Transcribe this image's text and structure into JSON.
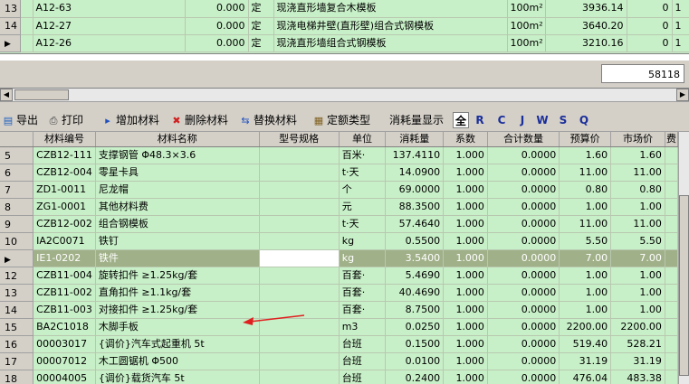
{
  "top_grid": {
    "rows": [
      {
        "num": "13",
        "code": "A12-63",
        "qty": "0.000",
        "flag": "定",
        "name": "现浇直形墙复合木模板",
        "unit": "100m²",
        "price": "3936.14",
        "a": "0",
        "b": "1"
      },
      {
        "num": "14",
        "code": "A12-27",
        "qty": "0.000",
        "flag": "定",
        "name": "现浇电梯井壁(直形壁)组合式钢模板",
        "unit": "100m²",
        "price": "3640.20",
        "a": "0",
        "b": "1"
      },
      {
        "num": "",
        "code": "A12-26",
        "qty": "0.000",
        "flag": "定",
        "name": "现浇直形墙组合式钢模板",
        "unit": "100m²",
        "price": "3210.16",
        "a": "0",
        "b": "1"
      }
    ],
    "summary_value": "58118"
  },
  "toolbar": {
    "export": "导出",
    "print": "打印",
    "add_material": "增加材料",
    "delete_material": "删除材料",
    "replace_material": "替换材料",
    "quota_type": "定额类型",
    "consumption_display": "消耗量显示",
    "letters": [
      "全",
      "R",
      "C",
      "J",
      "W",
      "S",
      "Q"
    ]
  },
  "main_grid": {
    "headers": [
      "材料编号",
      "材料名称",
      "型号规格",
      "单位",
      "消耗量",
      "系数",
      "合计数量",
      "预算价",
      "市场价",
      "费"
    ],
    "rows": [
      {
        "num": "5",
        "code": "CZB12-111",
        "name": "支撑钢管 Φ48.3×3.6",
        "spec": "",
        "unit": "百米·",
        "consumption": "137.4110",
        "coef": "1.000",
        "total": "0.0000",
        "budget": "1.60",
        "market": "1.60"
      },
      {
        "num": "6",
        "code": "CZB12-004",
        "name": "零星卡具",
        "spec": "",
        "unit": "t·天",
        "consumption": "14.0900",
        "coef": "1.000",
        "total": "0.0000",
        "budget": "11.00",
        "market": "11.00"
      },
      {
        "num": "7",
        "code": "ZD1-0011",
        "name": "尼龙帽",
        "spec": "",
        "unit": "个",
        "consumption": "69.0000",
        "coef": "1.000",
        "total": "0.0000",
        "budget": "0.80",
        "market": "0.80"
      },
      {
        "num": "8",
        "code": "ZG1-0001",
        "name": "其他材料费",
        "spec": "",
        "unit": "元",
        "consumption": "88.3500",
        "coef": "1.000",
        "total": "0.0000",
        "budget": "1.00",
        "market": "1.00"
      },
      {
        "num": "9",
        "code": "CZB12-002",
        "name": "组合钢模板",
        "spec": "",
        "unit": "t·天",
        "consumption": "57.4640",
        "coef": "1.000",
        "total": "0.0000",
        "budget": "11.00",
        "market": "11.00"
      },
      {
        "num": "10",
        "code": "IA2C0071",
        "name": "铁钉",
        "spec": "",
        "unit": "kg",
        "consumption": "0.5500",
        "coef": "1.000",
        "total": "0.0000",
        "budget": "5.50",
        "market": "5.50"
      },
      {
        "num": "",
        "code": "IE1-0202",
        "name": "铁件",
        "spec": "",
        "unit": "kg",
        "consumption": "3.5400",
        "coef": "1.000",
        "total": "0.0000",
        "budget": "7.00",
        "market": "7.00"
      },
      {
        "num": "12",
        "code": "CZB11-004",
        "name": "旋转扣件 ≥1.25kg/套",
        "spec": "",
        "unit": "百套·",
        "consumption": "5.4690",
        "coef": "1.000",
        "total": "0.0000",
        "budget": "1.00",
        "market": "1.00"
      },
      {
        "num": "13",
        "code": "CZB11-002",
        "name": "直角扣件 ≥1.1kg/套",
        "spec": "",
        "unit": "百套·",
        "consumption": "40.4690",
        "coef": "1.000",
        "total": "0.0000",
        "budget": "1.00",
        "market": "1.00"
      },
      {
        "num": "14",
        "code": "CZB11-003",
        "name": "对接扣件 ≥1.25kg/套",
        "spec": "",
        "unit": "百套·",
        "consumption": "8.7500",
        "coef": "1.000",
        "total": "0.0000",
        "budget": "1.00",
        "market": "1.00"
      },
      {
        "num": "15",
        "code": "BA2C1018",
        "name": "木脚手板",
        "spec": "",
        "unit": "m3",
        "consumption": "0.0250",
        "coef": "1.000",
        "total": "0.0000",
        "budget": "2200.00",
        "market": "2200.00"
      },
      {
        "num": "16",
        "code": "00003017",
        "name": "{调价}汽车式起重机 5t",
        "spec": "",
        "unit": "台班",
        "consumption": "0.1500",
        "coef": "1.000",
        "total": "0.0000",
        "budget": "519.40",
        "market": "528.21"
      },
      {
        "num": "17",
        "code": "00007012",
        "name": "木工圆锯机 Φ500",
        "spec": "",
        "unit": "台班",
        "consumption": "0.0100",
        "coef": "1.000",
        "total": "0.0000",
        "budget": "31.19",
        "market": "31.19"
      },
      {
        "num": "18",
        "code": "00004005",
        "name": "{调价}载货汽车 5t",
        "spec": "",
        "unit": "台班",
        "consumption": "0.2400",
        "coef": "1.000",
        "total": "0.0000",
        "budget": "476.04",
        "market": "483.38"
      }
    ]
  },
  "colors": {
    "grid_bg": "#c8f0c8",
    "selected_row": "#a0b088",
    "annotation_arrow": "#e02020"
  }
}
